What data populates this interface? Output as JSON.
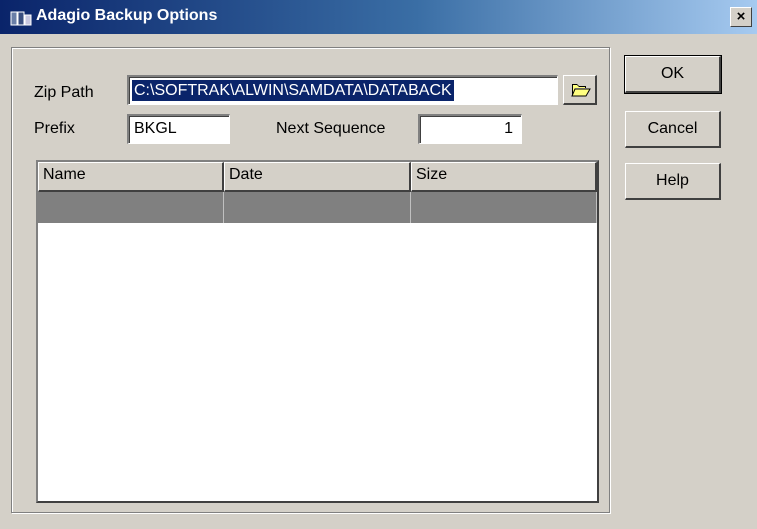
{
  "window": {
    "title": "Adagio Backup Options",
    "close_label": "×"
  },
  "form": {
    "zip_path_label": "Zip Path",
    "zip_path_value": "C:\\SOFTRAK\\ALWIN\\SAMDATA\\DATABACK",
    "prefix_label": "Prefix",
    "prefix_value": "BKGL",
    "next_sequence_label": "Next Sequence",
    "next_sequence_value": "1"
  },
  "table": {
    "columns": [
      "Name",
      "Date",
      "Size"
    ],
    "rows": [
      [
        "",
        "",
        ""
      ]
    ]
  },
  "buttons": {
    "ok": "OK",
    "cancel": "Cancel",
    "help": "Help"
  },
  "icons": {
    "title": "app-icon",
    "browse": "folder-open-icon"
  },
  "colors": {
    "selection": "#0a246a",
    "titlebar": "#0a246a",
    "face": "#d4d0c8"
  }
}
